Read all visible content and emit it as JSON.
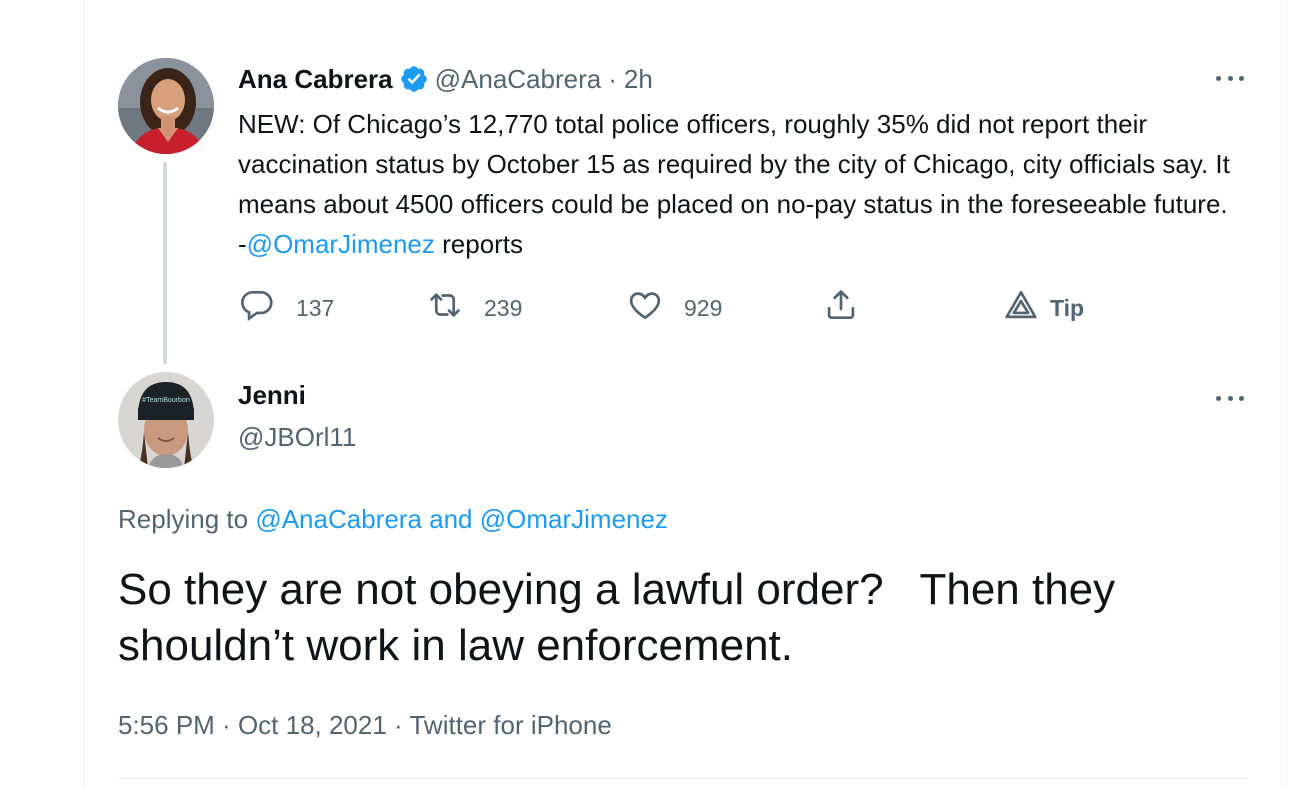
{
  "parent_tweet": {
    "display_name": "Ana Cabrera",
    "handle": "@AnaCabrera",
    "separator": "·",
    "time": "2h",
    "verified": true,
    "text_before_mention": "NEW: Of Chicago’s 12,770 total police officers, roughly 35% did not report their vaccination status by October 15 as required by the city of Chicago, city officials say. It means about 4500 officers could be placed on no-pay status in the foreseeable future. -",
    "mention": "@OmarJimenez",
    "text_after_mention": " reports",
    "actions": {
      "replies": "137",
      "retweets": "239",
      "likes": "929",
      "tip_label": "Tip"
    },
    "avatar_icon": "avatar-ana-cabrera"
  },
  "reply_tweet": {
    "display_name": "Jenni",
    "handle": "@JBOrl11",
    "replying_prefix": "Replying to ",
    "replying_mention_1": "@AnaCabrera",
    "replying_joiner": " and ",
    "replying_mention_2": "@OmarJimenez",
    "text": "So they are not obeying a lawful order?   Then they shouldn’t work in law enforcement.",
    "time": "5:56 PM",
    "separator_1": " · ",
    "date": "Oct 18, 2021",
    "separator_2": " · ",
    "source": "Twitter for iPhone",
    "avatar_icon": "avatar-jenni"
  },
  "colors": {
    "accent": "#1d9bf0",
    "secondary_text": "#536471",
    "primary_text": "#0f1419",
    "thread_line": "#cfd9de"
  }
}
